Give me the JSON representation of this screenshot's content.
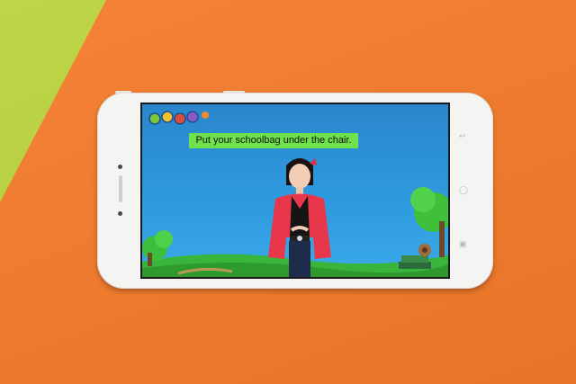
{
  "video": {
    "caption": "Put your schoolbag under the chair."
  },
  "icons": {
    "back": "back-icon",
    "home": "home-icon",
    "recents": "recents-icon",
    "nav_back_glyph": "↩",
    "nav_home_glyph": "◯",
    "nav_recents_glyph": "▣"
  },
  "colors": {
    "backdrop_orange": "#f47a2a",
    "backdrop_green": "#b9d33c",
    "phone_body": "#f4f4f2",
    "caption_bg": "#6fe14a",
    "sky": "#2f9be0",
    "grass": "#38b53a",
    "jacket": "#e8364a"
  }
}
